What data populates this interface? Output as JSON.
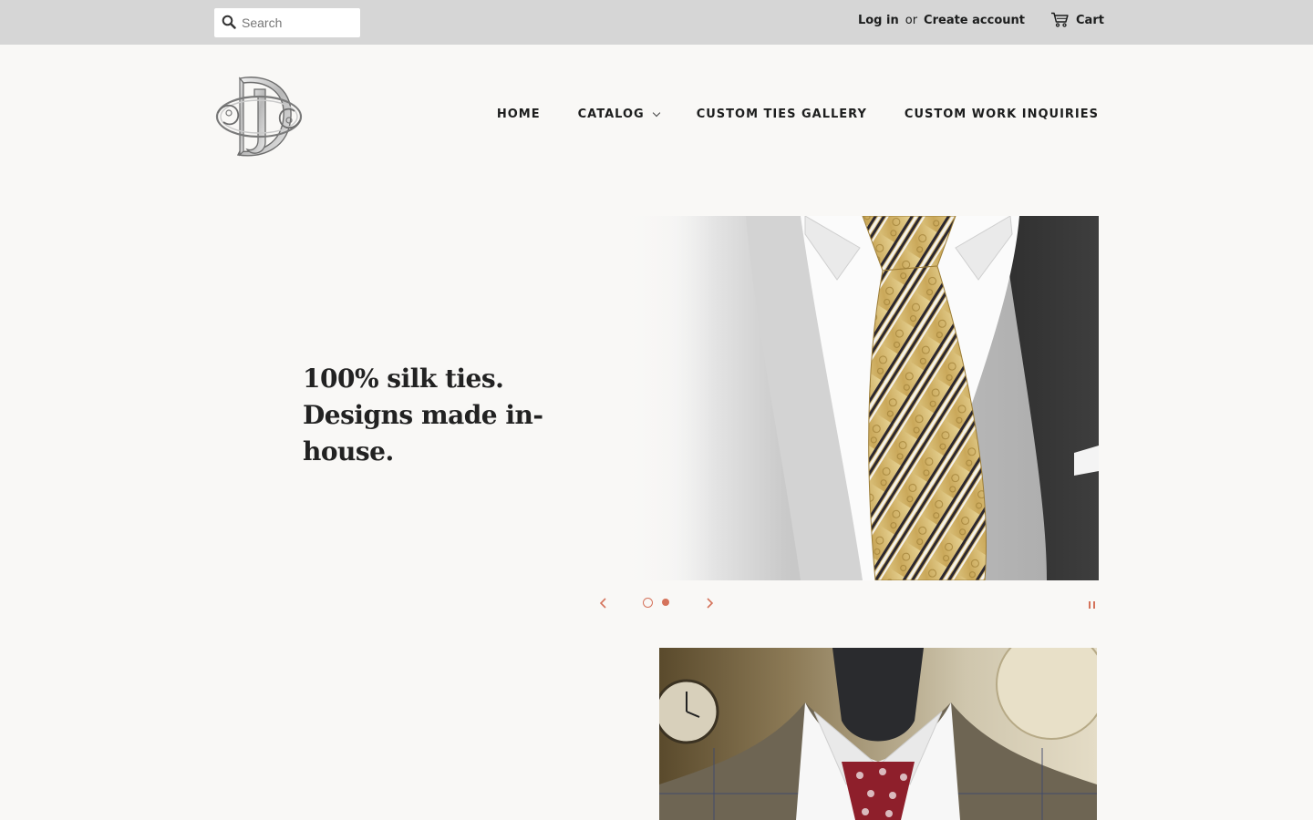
{
  "topbar": {
    "search_placeholder": "Search",
    "login_label": "Log in",
    "or_label": "or",
    "create_account_label": "Create account",
    "cart_label": "Cart"
  },
  "nav": {
    "items": [
      {
        "label": "HOME"
      },
      {
        "label": "CATALOG"
      },
      {
        "label": "CUSTOM TIES GALLERY"
      },
      {
        "label": "CUSTOM WORK INQUIRIES"
      }
    ]
  },
  "hero": {
    "headline": "100% silk ties. Designs made in-house."
  },
  "slider": {
    "slide_count": 2,
    "active_slide": 1
  },
  "colors": {
    "accent": "#d5735b",
    "topbar_bg": "#d6d6d6",
    "page_bg": "#f9f8f6",
    "text": "#1c1d1d"
  },
  "icons": [
    "search-icon",
    "cart-icon",
    "chevron-down-icon",
    "chevron-left-icon",
    "chevron-right-icon",
    "pause-icon"
  ]
}
